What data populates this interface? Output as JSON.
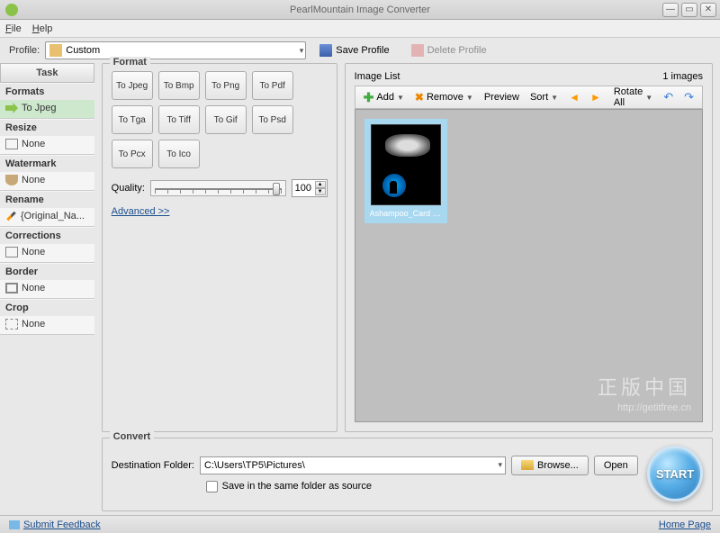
{
  "title": "PearlMountain Image Converter",
  "menu": {
    "file": "File",
    "help": "Help"
  },
  "profile": {
    "label": "Profile:",
    "value": "Custom",
    "save": "Save Profile",
    "delete": "Delete Profile"
  },
  "sidebar": {
    "header": "Task",
    "groups": [
      {
        "title": "Formats",
        "item": "To Jpeg",
        "icon": "arrow",
        "sel": true
      },
      {
        "title": "Resize",
        "item": "None",
        "icon": "box"
      },
      {
        "title": "Watermark",
        "item": "None",
        "icon": "drop"
      },
      {
        "title": "Rename",
        "item": "{Original_Na...",
        "icon": "pen"
      },
      {
        "title": "Corrections",
        "item": "None",
        "icon": "box"
      },
      {
        "title": "Border",
        "item": "None",
        "icon": "frame"
      },
      {
        "title": "Crop",
        "item": "None",
        "icon": "crop"
      }
    ]
  },
  "format": {
    "legend": "Format",
    "buttons": [
      "To Jpeg",
      "To Bmp",
      "To Png",
      "To Pdf",
      "To Tga",
      "To Tiff",
      "To Gif",
      "To Psd",
      "To Pcx",
      "To Ico"
    ],
    "quality_label": "Quality:",
    "quality_value": "100",
    "advanced": "Advanced >>"
  },
  "imagelist": {
    "legend": "Image List",
    "count": "1 images",
    "toolbar": {
      "add": "Add",
      "remove": "Remove",
      "preview": "Preview",
      "sort": "Sort",
      "rotate": "Rotate All"
    },
    "thumb_label": "Ashampoo_Card - 20...",
    "watermark_cn": "正版中国",
    "watermark_url": "http://getitfree.cn"
  },
  "convert": {
    "legend": "Convert",
    "dest_label": "Destination Folder:",
    "dest_value": "C:\\Users\\TP5\\Pictures\\",
    "browse": "Browse...",
    "open": "Open",
    "same_folder": "Save in the same folder as source",
    "start": "START"
  },
  "footer": {
    "feedback": "Submit Feedback",
    "home": "Home Page"
  }
}
